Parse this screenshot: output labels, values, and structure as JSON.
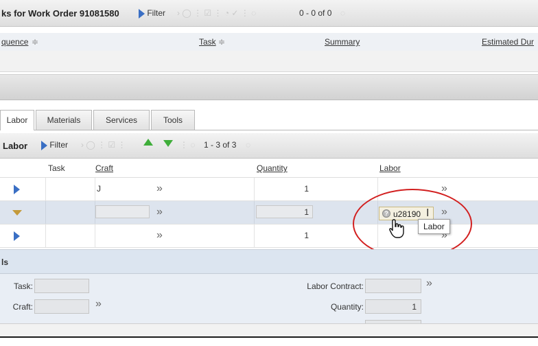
{
  "tasks_toolbar": {
    "title": "ks for Work Order 91081580",
    "filter_label": "Filter",
    "pagination": "0 - 0 of 0"
  },
  "tasks_table": {
    "columns": [
      "quence",
      "Task",
      "Summary",
      "Estimated Dur"
    ]
  },
  "tabs": [
    {
      "label": "Labor",
      "active": true
    },
    {
      "label": "Materials",
      "active": false
    },
    {
      "label": "Services",
      "active": false
    },
    {
      "label": "Tools",
      "active": false
    }
  ],
  "labor_toolbar": {
    "title": "Labor",
    "filter_label": "Filter",
    "pagination": "1 - 3 of 3"
  },
  "labor_table": {
    "columns": {
      "task": "Task",
      "craft": "Craft",
      "quantity": "Quantity",
      "labor": "Labor"
    },
    "rows": [
      {
        "craft": "J",
        "quantity": "1",
        "labor": ""
      },
      {
        "craft": "",
        "quantity": "1",
        "labor": "u28190"
      },
      {
        "craft": "",
        "quantity": "1",
        "labor": ""
      }
    ],
    "lookup_glyph": "»",
    "tooltip": "Labor"
  },
  "details": {
    "title": "ls",
    "task_label": "Task:",
    "craft_label": "Craft:",
    "labor_contract_label": "Labor Contract:",
    "quantity_label": "Quantity:",
    "quantity_value": "1"
  },
  "colors": {
    "highlight_circle": "#d21f1f",
    "arrow_green": "#3fae3a",
    "row_arrow_blue": "#3a6fc4"
  }
}
